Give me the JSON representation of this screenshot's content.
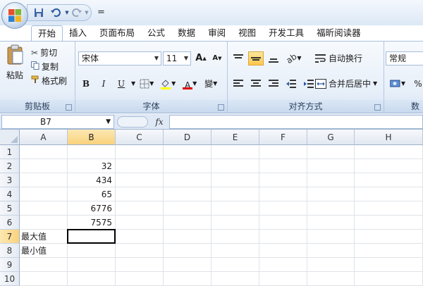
{
  "quick_access": {
    "save_icon": "save-icon",
    "undo_icon": "undo-icon",
    "redo_icon": "redo-icon",
    "customize_label": "="
  },
  "tabs": [
    {
      "label": "开始",
      "active": true
    },
    {
      "label": "插入"
    },
    {
      "label": "页面布局"
    },
    {
      "label": "公式"
    },
    {
      "label": "数据"
    },
    {
      "label": "审阅"
    },
    {
      "label": "视图"
    },
    {
      "label": "开发工具"
    },
    {
      "label": "福昕阅读器"
    }
  ],
  "ribbon": {
    "clipboard": {
      "label": "剪贴板",
      "paste": "粘贴",
      "cut": "剪切",
      "copy": "复制",
      "format_painter": "格式刷"
    },
    "font": {
      "label": "字体",
      "font_name": "宋体",
      "font_size": "11",
      "bold": "B",
      "italic": "I",
      "underline": "U",
      "grow": "A",
      "shrink": "A",
      "font_color_letter": "A",
      "phonetic": "變",
      "fill_color": "#ffff00",
      "font_color": "#e00000"
    },
    "alignment": {
      "label": "对齐方式",
      "wrap_text": "自动换行",
      "merge_center": "合并后居中"
    },
    "number": {
      "label": "数",
      "format": "常规",
      "percent": "%"
    }
  },
  "formula_bar": {
    "name_box": "B7",
    "fx": "fx",
    "value": ""
  },
  "grid": {
    "columns": [
      "A",
      "B",
      "C",
      "D",
      "E",
      "F",
      "G",
      "H"
    ],
    "rows": [
      "1",
      "2",
      "3",
      "4",
      "5",
      "6",
      "7",
      "8",
      "9",
      "10"
    ],
    "active_cell": "B7",
    "cells": {
      "B2": "32",
      "B3": "434",
      "B4": "65",
      "B5": "6776",
      "B6": "7575",
      "A7": "最大值",
      "A8": "最小值"
    }
  }
}
